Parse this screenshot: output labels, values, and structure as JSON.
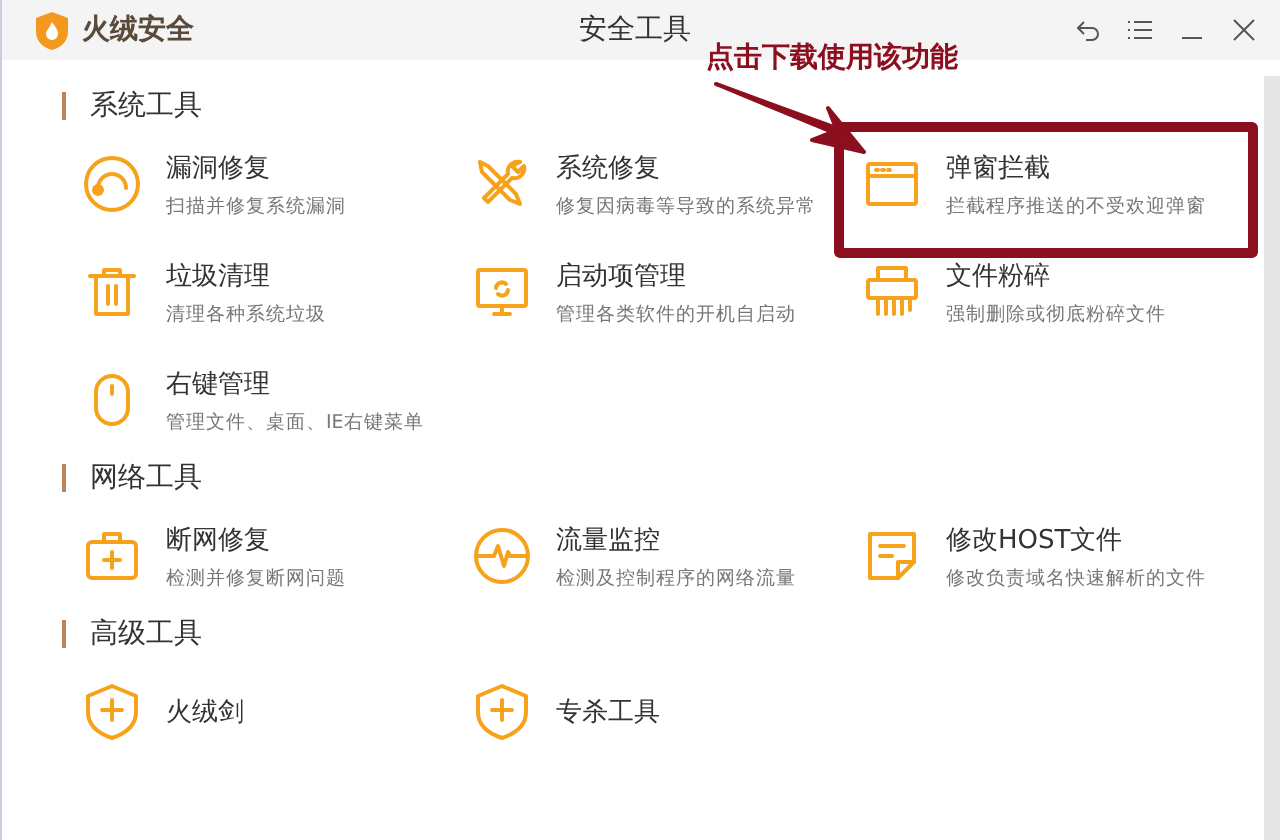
{
  "window": {
    "app_name": "火绒安全",
    "title": "安全工具"
  },
  "annotation": {
    "text": "点击下载使用该功能"
  },
  "sections": [
    {
      "title": "系统工具",
      "items": [
        {
          "kind": "headset",
          "name": "漏洞修复",
          "desc": "扫描并修复系统漏洞"
        },
        {
          "kind": "tools",
          "name": "系统修复",
          "desc": "修复因病毒等导致的系统异常"
        },
        {
          "kind": "window",
          "name": "弹窗拦截",
          "desc": "拦截程序推送的不受欢迎弹窗",
          "highlighted": true
        },
        {
          "kind": "trash",
          "name": "垃圾清理",
          "desc": "清理各种系统垃圾"
        },
        {
          "kind": "monitor",
          "name": "启动项管理",
          "desc": "管理各类软件的开机自启动"
        },
        {
          "kind": "shredder",
          "name": "文件粉碎",
          "desc": "强制删除或彻底粉碎文件"
        },
        {
          "kind": "mouse",
          "name": "右键管理",
          "desc": "管理文件、桌面、IE右键菜单"
        }
      ]
    },
    {
      "title": "网络工具",
      "items": [
        {
          "kind": "kit",
          "name": "断网修复",
          "desc": "检测并修复断网问题"
        },
        {
          "kind": "pulse",
          "name": "流量监控",
          "desc": "检测及控制程序的网络流量"
        },
        {
          "kind": "note",
          "name": "修改HOST文件",
          "desc": "修改负责域名快速解析的文件"
        }
      ]
    },
    {
      "title": "高级工具",
      "items": [
        {
          "kind": "shield",
          "name": "火绒剑"
        },
        {
          "kind": "shield",
          "name": "专杀工具"
        }
      ]
    }
  ]
}
